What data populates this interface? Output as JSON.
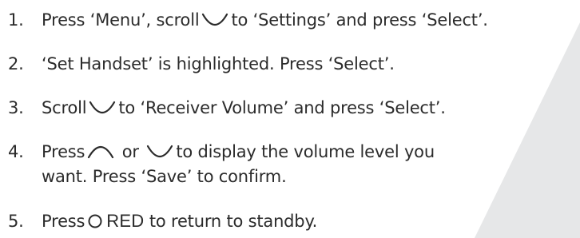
{
  "steps": [
    {
      "number": "1.",
      "before": "Press ‘Menu’, scroll",
      "icon": "scroll-down-icon",
      "after": "to ‘Settings’ and press ‘Select’."
    },
    {
      "number": "2.",
      "text": "‘Set Handset’ is highlighted. Press ‘Select’."
    },
    {
      "number": "3.",
      "before": "Scroll",
      "icon": "scroll-down-icon",
      "after": "to ‘Receiver Volume’ and press ‘Select’."
    },
    {
      "number": "4.",
      "before": "Press",
      "icon_up": "scroll-up-icon",
      "middle": "or",
      "icon_down": "scroll-down-icon",
      "after": "to display the volume level you",
      "continuation": "want.  Press ‘Save’ to confirm."
    },
    {
      "number": "5.",
      "before": "Press",
      "icon": "red-button-icon",
      "key_label": "RED",
      "after": "to return to standby."
    }
  ],
  "colors": {
    "text": "#2b2b2b",
    "background": "#ffffff",
    "accent_panel": "#e6e7e8"
  }
}
